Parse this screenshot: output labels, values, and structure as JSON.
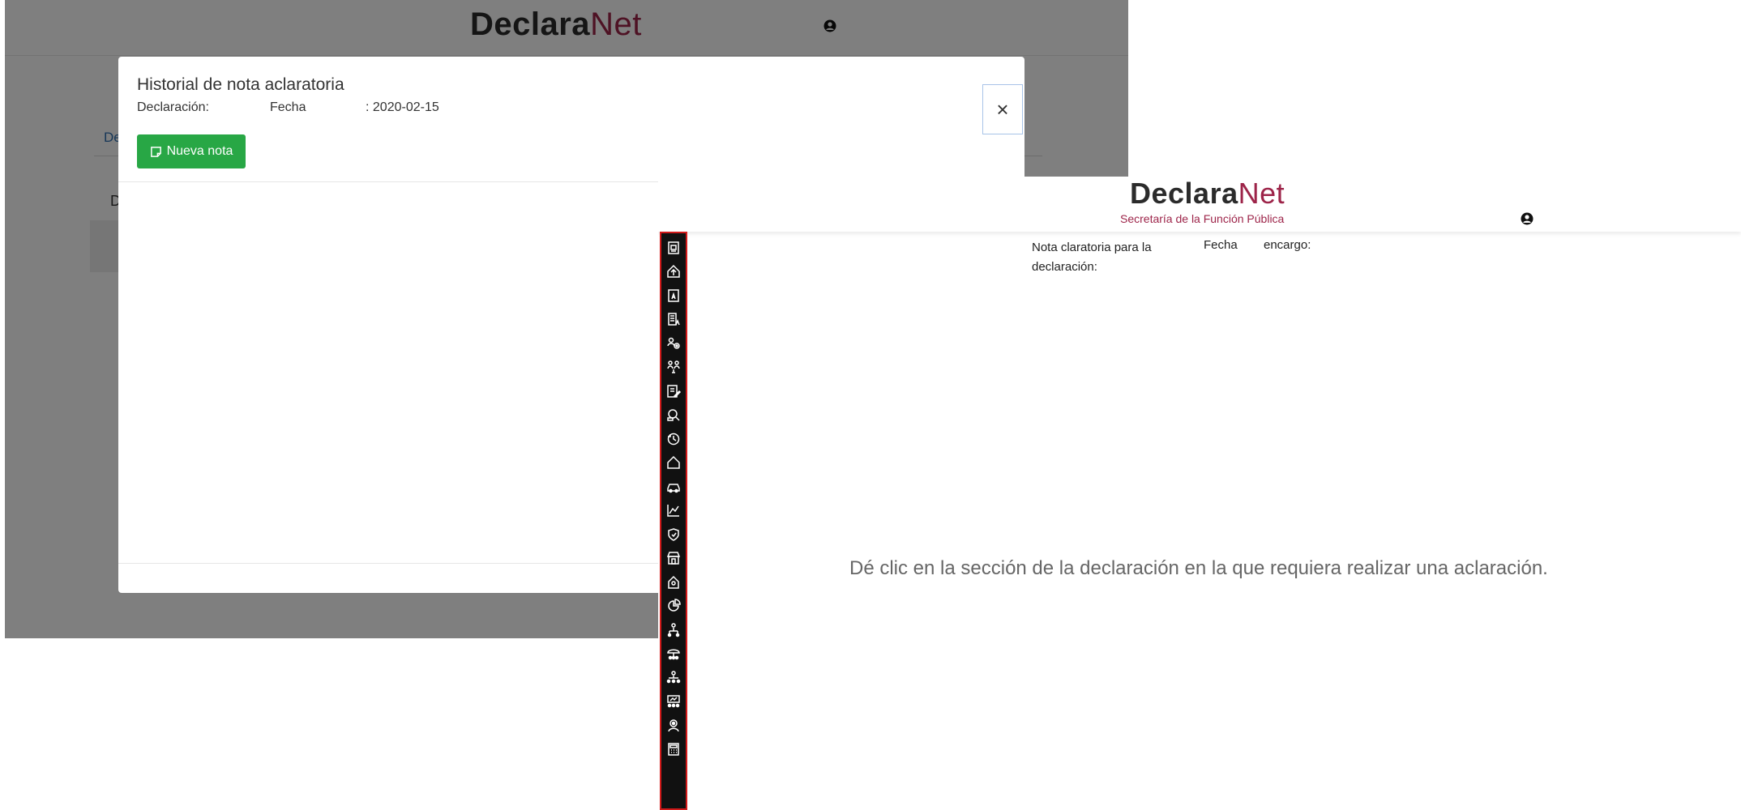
{
  "left": {
    "brand": {
      "bold": "Declara",
      "light": "Net"
    },
    "bg_tab_fragment": "De",
    "bg_cell_fragment": "D",
    "modal": {
      "title": "Historial de nota aclaratoria",
      "declaracion_label": "Declaración:",
      "fecha_label": "Fecha",
      "fecha_value": ": 2020-02-15",
      "new_note_button": "Nueva nota",
      "close_symbol": "×"
    }
  },
  "right": {
    "brand": {
      "bold": "Declara",
      "light": "Net"
    },
    "subtitle": "Secretaría de la Función Pública",
    "note_label": "Nota claratoria para la declaración:",
    "fecha_label": "Fecha",
    "encargo_label": "encargo:",
    "instruction": "Dé clic en la sección de la declaración en la que requiera realizar una aclaración.",
    "sidebar_icons": [
      "id-card-icon",
      "upload-home-icon",
      "document-a-icon",
      "building-a-icon",
      "people-gear-icon",
      "family-icon",
      "form-edit-icon",
      "search-settings-icon",
      "history-icon",
      "home-icon",
      "car-icon",
      "line-chart-icon",
      "shield-hand-icon",
      "shop-icon",
      "house-location-icon",
      "pie-chart-icon",
      "person-hierarchy-icon",
      "umbrella-group-icon",
      "group-hierarchy-icon",
      "presentation-group-icon",
      "person-badge-icon",
      "calculator-icon"
    ]
  },
  "colors": {
    "brand_accent": "#9d2449",
    "success": "#28a745",
    "sidebar_bg": "#111111",
    "sidebar_border": "#d11a1a"
  }
}
